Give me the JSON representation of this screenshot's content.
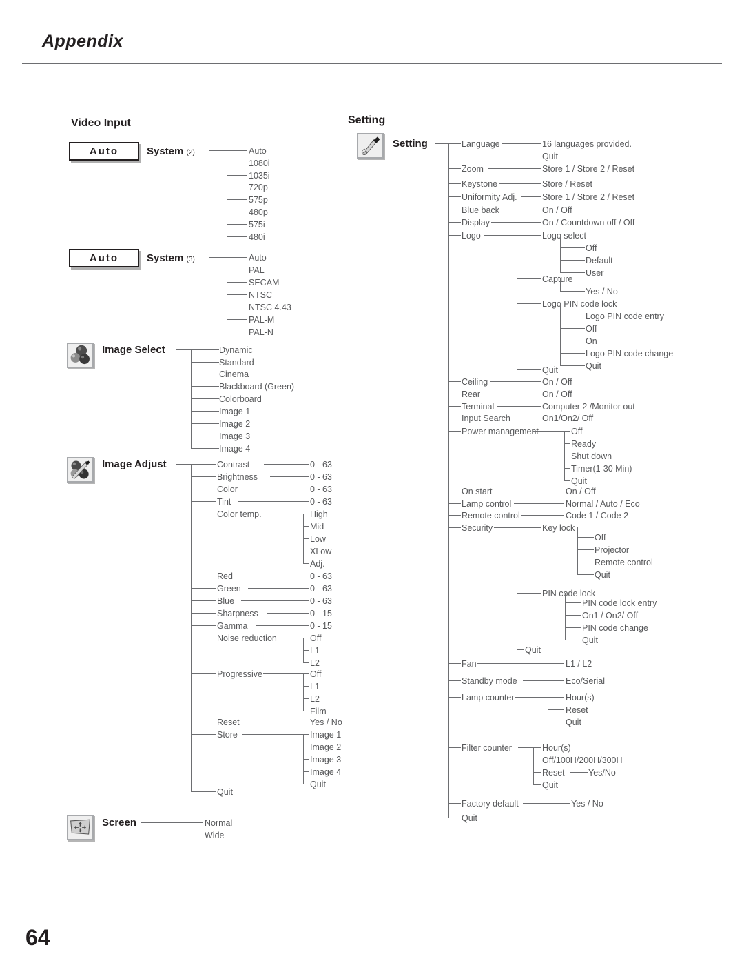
{
  "header": {
    "title": "Appendix"
  },
  "footer": {
    "page_number": "64"
  },
  "sections": {
    "video_input": {
      "title": "Video Input"
    },
    "setting": {
      "title": "Setting"
    }
  },
  "video_input": {
    "system2": {
      "box_label": "Auto",
      "head": "System",
      "sub": "(2)",
      "options": [
        "Auto",
        "1080i",
        "1035i",
        "720p",
        "575p",
        "480p",
        "575i",
        "480i"
      ]
    },
    "system3": {
      "box_label": "Auto",
      "head": "System",
      "sub": "(3)",
      "options": [
        "Auto",
        "PAL",
        "SECAM",
        "NTSC",
        "NTSC 4.43",
        "PAL-M",
        "PAL-N"
      ]
    },
    "image_select": {
      "icon": "spheres-icon",
      "head": "Image Select",
      "options": [
        "Dynamic",
        "Standard",
        "Cinema",
        "Blackboard (Green)",
        "Colorboard",
        "Image 1",
        "Image 2",
        "Image 3",
        "Image 4"
      ]
    },
    "image_adjust": {
      "icon": "spheres-brush-icon",
      "head": "Image Adjust",
      "items": [
        {
          "label": "Contrast",
          "value": "0 - 63"
        },
        {
          "label": "Brightness",
          "value": "0 - 63"
        },
        {
          "label": "Color",
          "value": "0 - 63"
        },
        {
          "label": "Tint",
          "value": "0 - 63"
        },
        {
          "label": "Color temp.",
          "children": [
            "High",
            "Mid",
            "Low",
            "XLow",
            "Adj."
          ]
        },
        {
          "label": "Red",
          "value": "0 - 63"
        },
        {
          "label": "Green",
          "value": "0 - 63"
        },
        {
          "label": "Blue",
          "value": "0 - 63"
        },
        {
          "label": "Sharpness",
          "value": "0 - 15"
        },
        {
          "label": "Gamma",
          "value": "0 - 15"
        },
        {
          "label": "Noise reduction",
          "children": [
            "Off",
            "L1",
            "L2"
          ]
        },
        {
          "label": "Progressive",
          "children": [
            "Off",
            "L1",
            "L2",
            "Film"
          ]
        },
        {
          "label": "Reset",
          "value": "Yes / No"
        },
        {
          "label": "Store",
          "children": [
            "Image 1",
            "Image 2",
            "Image 3",
            "Image 4",
            "Quit"
          ]
        },
        {
          "label": "Quit"
        }
      ]
    },
    "screen": {
      "icon": "screen-icon",
      "head": "Screen",
      "options": [
        "Normal",
        "Wide"
      ]
    }
  },
  "setting": {
    "icon": "wrench-screwdriver-icon",
    "head": "Setting",
    "items": [
      {
        "label": "Language",
        "children": [
          "16 languages provided.",
          "Quit"
        ]
      },
      {
        "label": "Zoom",
        "value": "Store 1 / Store 2 / Reset"
      },
      {
        "label": "Keystone",
        "value": "Store / Reset"
      },
      {
        "label": "Uniformity Adj.",
        "value": "Store 1 / Store 2 / Reset"
      },
      {
        "label": "Blue back",
        "value": "On / Off"
      },
      {
        "label": "Display",
        "value": "On / Countdown off / Off"
      },
      {
        "label": "Logo",
        "children": [
          {
            "label": "Logo select",
            "children": [
              "Off",
              "Default",
              "User"
            ]
          },
          {
            "label": "Capture",
            "children": [
              "Yes / No"
            ]
          },
          {
            "label": "Logo PIN code lock",
            "children": [
              "Logo PIN code entry",
              "Off",
              "On",
              "Logo PIN code change",
              "Quit"
            ]
          },
          {
            "label": "Quit"
          }
        ]
      },
      {
        "label": "Ceiling",
        "value": "On / Off"
      },
      {
        "label": "Rear",
        "value": "On / Off"
      },
      {
        "label": "Terminal",
        "value": "Computer 2 /Monitor out"
      },
      {
        "label": "Input Search",
        "value": "On1/On2/ Off"
      },
      {
        "label": "Power management",
        "children": [
          "Off",
          "Ready",
          "Shut down",
          "Timer(1-30 Min)",
          "Quit"
        ]
      },
      {
        "label": "On start",
        "value": "On / Off"
      },
      {
        "label": "Lamp control",
        "value": "Normal / Auto / Eco"
      },
      {
        "label": "Remote control",
        "value": "Code 1 / Code 2"
      },
      {
        "label": "Security",
        "children": [
          {
            "label": "Key lock",
            "children": [
              "Off",
              "Projector",
              "Remote control",
              "Quit"
            ]
          },
          {
            "label": "PIN code lock",
            "children": [
              "PIN code lock entry",
              "On1 / On2/ Off",
              "PIN code change",
              "Quit"
            ]
          },
          {
            "label": "Quit"
          }
        ]
      },
      {
        "label": "Fan",
        "value": "L1 / L2"
      },
      {
        "label": "Standby mode",
        "value": "Eco/Serial"
      },
      {
        "label": "Lamp counter",
        "children": [
          "Hour(s)",
          "Reset",
          "Quit"
        ]
      },
      {
        "label": "Filter counter",
        "children": [
          "Hour(s)",
          "Off/100H/200H/300H",
          "Reset",
          "Quit"
        ],
        "reset_value": "Yes/No"
      },
      {
        "label": "Factory default",
        "value": "Yes / No"
      },
      {
        "label": "Quit"
      }
    ]
  }
}
